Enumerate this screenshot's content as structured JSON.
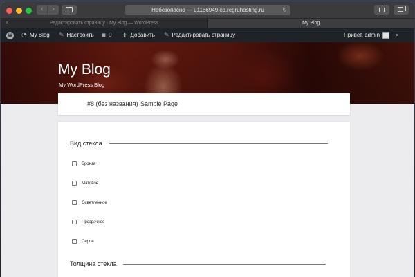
{
  "browser": {
    "url_text": "Небезопасно — u1186949.cp.regruhosting.ru",
    "reload_icon": "reload-icon",
    "tabs": [
      {
        "label": "Редактировать страницу ‹ My Blog — WordPress",
        "active": false
      },
      {
        "label": "My Blog",
        "active": true
      }
    ]
  },
  "adminbar": {
    "site_name": "My Blog",
    "customize": "Настроить",
    "comments_count": "0",
    "add_new": "Добавить",
    "edit_page": "Редактировать страницу",
    "greeting": "Привет, admin"
  },
  "header": {
    "title": "My Blog",
    "description": "My WordPress Blog"
  },
  "nav": {
    "items": [
      "#8 (без названия)",
      "Sample Page"
    ]
  },
  "content": {
    "section1_title": "Вид стекла",
    "options": [
      "Бронза",
      "Матовое",
      "Осветленное",
      "Прозрачное",
      "Серое"
    ],
    "section2_title": "Толщина стекла"
  },
  "colors": {
    "adminbar_bg": "#1d2327",
    "page_bg": "#ececef",
    "accent_close": "#fe5f57",
    "accent_min": "#febc2e",
    "accent_max": "#28c840"
  }
}
